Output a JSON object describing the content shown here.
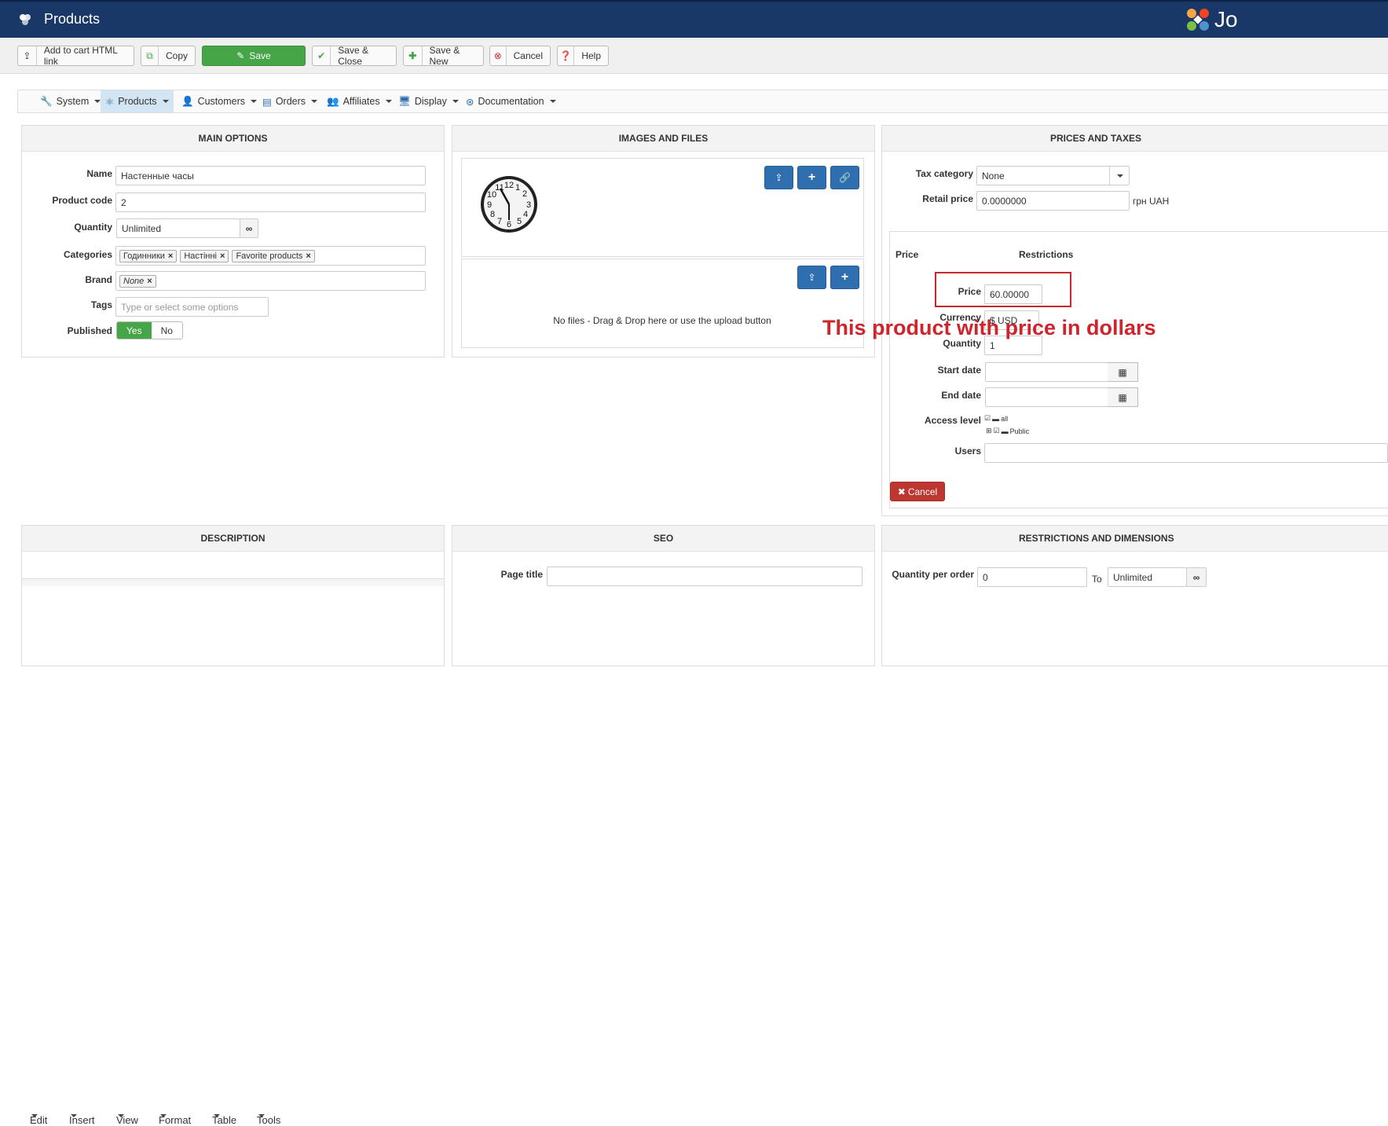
{
  "header": {
    "title": "Products",
    "brand_text": "Jo"
  },
  "toolbar": {
    "add_to_cart": "Add to cart HTML link",
    "copy": "Copy",
    "save": "Save",
    "save_close": "Save & Close",
    "save_new": "Save & New",
    "cancel": "Cancel",
    "help": "Help"
  },
  "menu": [
    "System",
    "Products",
    "Customers",
    "Orders",
    "Affiliates",
    "Display",
    "Documentation"
  ],
  "main_options": {
    "heading": "MAIN OPTIONS",
    "name_label": "Name",
    "name_value": "Настенные часы",
    "code_label": "Product code",
    "code_value": "2",
    "quantity_label": "Quantity",
    "quantity_value": "Unlimited",
    "categories_label": "Categories",
    "categories": [
      "Годинники",
      "Настінні",
      "Favorite products"
    ],
    "brand_label": "Brand",
    "brand_value": "None",
    "tags_label": "Tags",
    "tags_placeholder": "Type or select some options",
    "published_label": "Published",
    "published_yes": "Yes",
    "published_no": "No"
  },
  "images_files": {
    "heading": "IMAGES AND FILES",
    "no_files": "No files - Drag & Drop here or use the upload button"
  },
  "prices_taxes": {
    "heading": "PRICES AND TAXES",
    "tax_label": "Tax category",
    "tax_value": "None",
    "retail_label": "Retail price",
    "retail_value": "0.0000000",
    "retail_currency": "грн UAH",
    "col_price": "Price",
    "col_restrictions": "Restrictions",
    "price_label": "Price",
    "price_value": "60.00000",
    "currency_label": "Currency",
    "currency_value": "$ USD",
    "quantity_label": "Quantity",
    "quantity_value": "1",
    "start_label": "Start date",
    "end_label": "End date",
    "access_label": "Access level",
    "access_all": "all",
    "access_public": "Public",
    "users_label": "Users",
    "cancel": "Cancel"
  },
  "annotation": "This product with price in dollars",
  "description": {
    "heading": "DESCRIPTION",
    "menu": [
      "Edit",
      "Insert",
      "View",
      "Format",
      "Table",
      "Tools"
    ]
  },
  "seo": {
    "heading": "SEO",
    "page_title_label": "Page title"
  },
  "restrictions": {
    "heading": "RESTRICTIONS AND DIMENSIONS",
    "qty_per_order_label": "Quantity per order",
    "qty_from": "0",
    "to_label": "To",
    "qty_to": "Unlimited"
  }
}
